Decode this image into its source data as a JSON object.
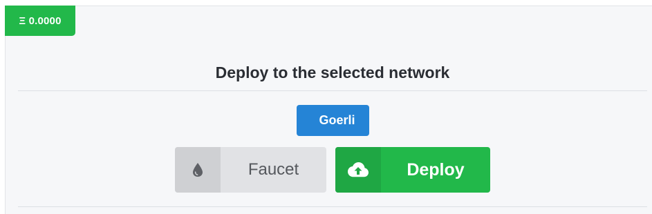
{
  "balance": {
    "label": "Ξ 0.0000"
  },
  "panel": {
    "title": "Deploy to the selected network"
  },
  "network": {
    "label": "Goerli"
  },
  "actions": {
    "faucet_label": "Faucet",
    "faucet_icon": "droplet-icon",
    "deploy_label": "Deploy",
    "deploy_icon": "cloud-upload-icon"
  },
  "colors": {
    "success": "#22b84a",
    "primary": "#2584d6",
    "neutral": "#e1e2e5"
  }
}
